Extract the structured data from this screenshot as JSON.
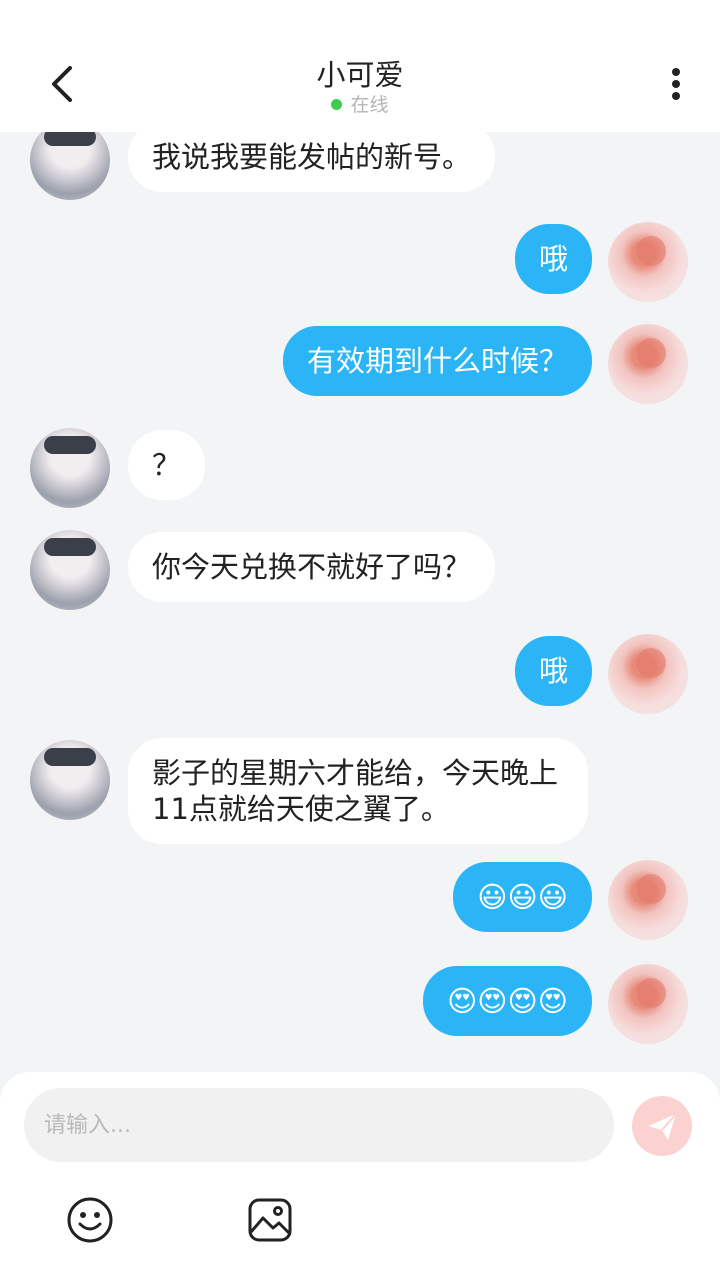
{
  "header": {
    "title": "小可爱",
    "status": "在线",
    "status_color": "#3ccf4e"
  },
  "messages": [
    {
      "side": "in",
      "text": "我说我要能发帖的新号。"
    },
    {
      "side": "out",
      "text": "哦"
    },
    {
      "side": "out",
      "text": "有效期到什么时候？"
    },
    {
      "side": "in",
      "text": "？"
    },
    {
      "side": "in",
      "text": "你今天兑换不就好了吗？"
    },
    {
      "side": "out",
      "text": "哦"
    },
    {
      "side": "in",
      "text": "影子的星期六才能给，今天晚上11点就给天使之翼了。"
    },
    {
      "side": "out",
      "text": "😃😃😃"
    },
    {
      "side": "out",
      "text": "😍😍😍😍"
    }
  ],
  "input": {
    "placeholder": "请输入..."
  },
  "colors": {
    "bubble_out": "#2bb5f7",
    "bubble_in": "#ffffff",
    "chat_background": "#f3f4f6"
  },
  "icons": {
    "back": "chevron-left-icon",
    "more": "more-vertical-icon",
    "send": "send-icon",
    "emoji": "smiley-icon",
    "image": "image-icon"
  }
}
